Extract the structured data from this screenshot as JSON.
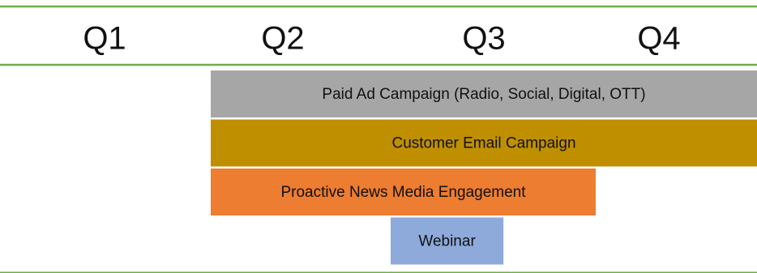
{
  "chart_data": {
    "type": "bar",
    "orientation": "horizontal-timeline",
    "categories": [
      "Q1",
      "Q2",
      "Q3",
      "Q4"
    ],
    "x_range": [
      0,
      4
    ],
    "grid": false,
    "items": [
      {
        "label": "Paid Ad Campaign (Radio, Social, Digital, OTT)",
        "start": 1.0,
        "end": 4.0,
        "color": "#a6a6a6"
      },
      {
        "label": "Customer Email Campaign",
        "start": 1.0,
        "end": 4.0,
        "color": "#bf8f00"
      },
      {
        "label": "Proactive News Media Engagement",
        "start": 1.0,
        "end": 3.0,
        "color": "#ed7d31"
      },
      {
        "label": "Webinar",
        "start": 2.0,
        "end": 2.55,
        "color": "#8eaadb"
      }
    ]
  },
  "colors": {
    "rule": "#70ad47"
  }
}
